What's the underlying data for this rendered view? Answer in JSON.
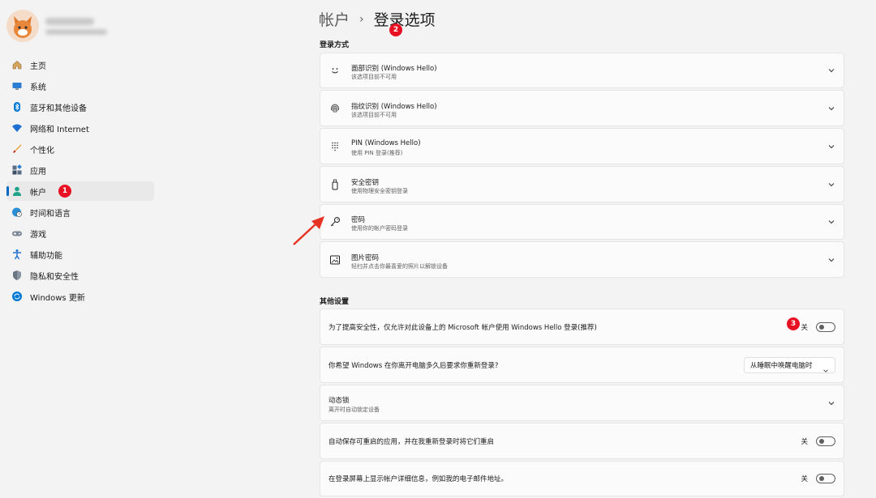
{
  "sidebar": {
    "items": [
      {
        "label": "主页",
        "icon": "home-icon"
      },
      {
        "label": "系统",
        "icon": "monitor-icon"
      },
      {
        "label": "蓝牙和其他设备",
        "icon": "bluetooth-icon"
      },
      {
        "label": "网络和 Internet",
        "icon": "wifi-icon"
      },
      {
        "label": "个性化",
        "icon": "brush-icon"
      },
      {
        "label": "应用",
        "icon": "apps-icon"
      },
      {
        "label": "帐户",
        "icon": "person-icon",
        "active": true
      },
      {
        "label": "时间和语言",
        "icon": "globe-clock-icon"
      },
      {
        "label": "游戏",
        "icon": "gamepad-icon"
      },
      {
        "label": "辅助功能",
        "icon": "accessibility-icon"
      },
      {
        "label": "隐私和安全性",
        "icon": "shield-icon"
      },
      {
        "label": "Windows 更新",
        "icon": "update-icon"
      }
    ]
  },
  "annotations": {
    "badge1": "1",
    "badge2": "2",
    "badge3": "3"
  },
  "breadcrumb": {
    "parent": "帐户",
    "separator": "›",
    "current": "登录选项"
  },
  "login_methods": {
    "title": "登录方式",
    "items": [
      {
        "title": "面部识别 (Windows Hello)",
        "subtitle": "该选项目前不可用",
        "icon": "face-icon"
      },
      {
        "title": "指纹识别 (Windows Hello)",
        "subtitle": "该选项目前不可用",
        "icon": "fingerprint-icon"
      },
      {
        "title": "PIN (Windows Hello)",
        "subtitle": "使用 PIN 登录(推荐)",
        "icon": "pin-keypad-icon"
      },
      {
        "title": "安全密钥",
        "subtitle": "使用物理安全密钥登录",
        "icon": "usb-key-icon"
      },
      {
        "title": "密码",
        "subtitle": "使用你的帐户密码登录",
        "icon": "key-icon"
      },
      {
        "title": "图片密码",
        "subtitle": "轻扫并点击你最喜爱的照片以解锁设备",
        "icon": "picture-icon"
      }
    ]
  },
  "other_settings": {
    "title": "其他设置",
    "hello_only": {
      "label": "为了提高安全性，仅允许对此设备上的 Microsoft 帐户使用 Windows Hello 登录(推荐)",
      "state": "关"
    },
    "require_signin": {
      "label": "你希望 Windows 在你离开电脑多久后要求你重新登录?",
      "value": "从睡眠中唤醒电脑时"
    },
    "dynamic_lock": {
      "title": "动态锁",
      "subtitle": "离开时自动锁定设备"
    },
    "restart_apps": {
      "label": "自动保存可重启的应用，并在我重新登录时将它们重启",
      "state": "关"
    },
    "show_details": {
      "label": "在登录屏幕上显示帐户详细信息，例如我的电子邮件地址。",
      "state": "关"
    }
  },
  "colors": {
    "accent": "#0067c0",
    "badge": "#e81123",
    "arrow": "#e63323"
  }
}
